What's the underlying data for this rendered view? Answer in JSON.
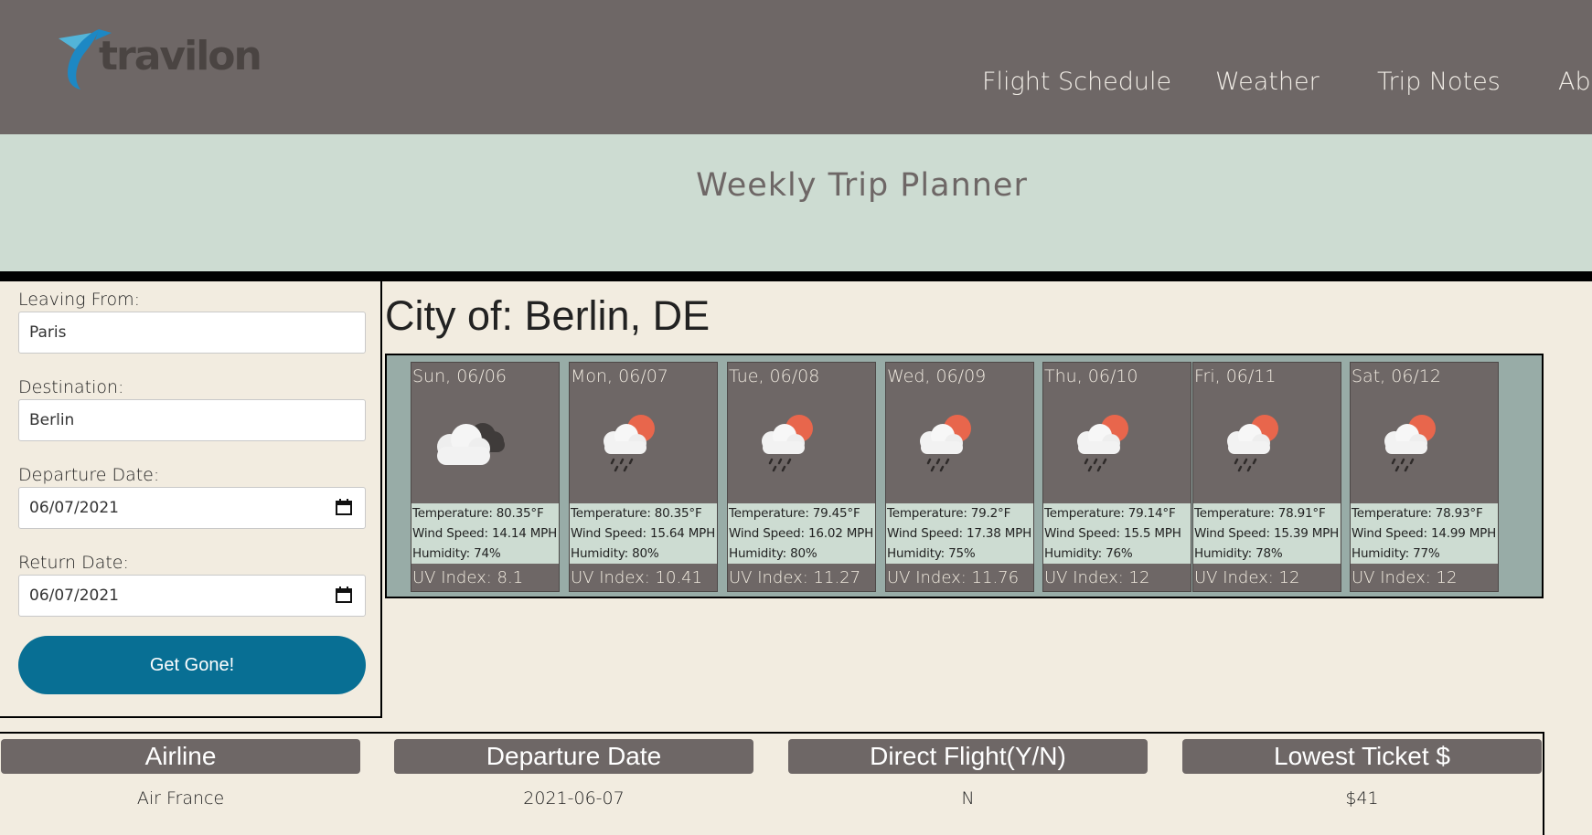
{
  "header": {
    "logo_text": "travilon",
    "nav": [
      "Flight Schedule",
      "Weather",
      "Trip Notes",
      "Abo"
    ]
  },
  "banner": {
    "title": "Weekly Trip Planner"
  },
  "form": {
    "leaving_label": "Leaving From:",
    "leaving_value": "Paris",
    "destination_label": "Destination:",
    "destination_value": "Berlin",
    "departure_label": "Departure Date:",
    "departure_value": "06/07/2021",
    "return_label": "Return Date:",
    "return_value": "06/07/2021",
    "submit_label": "Get Gone!"
  },
  "city": {
    "title": "City of: Berlin, DE"
  },
  "forecast": [
    {
      "date": "Sun, 06/06",
      "icon": "cloudy-icon",
      "temp": "Temperature: 80.35°F",
      "wind": "Wind Speed: 14.14 MPH",
      "humidity": "Humidity: 74%",
      "uv": "UV Index: 8.1"
    },
    {
      "date": "Mon, 06/07",
      "icon": "rain-sun-icon",
      "temp": "Temperature: 80.35°F",
      "wind": "Wind Speed: 15.64 MPH",
      "humidity": "Humidity: 80%",
      "uv": "UV Index: 10.41"
    },
    {
      "date": "Tue, 06/08",
      "icon": "rain-sun-icon",
      "temp": "Temperature: 79.45°F",
      "wind": "Wind Speed: 16.02 MPH",
      "humidity": "Humidity: 80%",
      "uv": "UV Index: 11.27"
    },
    {
      "date": "Wed, 06/09",
      "icon": "rain-sun-icon",
      "temp": "Temperature: 79.2°F",
      "wind": "Wind Speed: 17.38 MPH",
      "humidity": "Humidity: 75%",
      "uv": "UV Index: 11.76"
    },
    {
      "date": "Thu, 06/10",
      "icon": "rain-sun-icon",
      "temp": "Temperature: 79.14°F",
      "wind": "Wind Speed: 15.5 MPH",
      "humidity": "Humidity: 76%",
      "uv": "UV Index: 12"
    },
    {
      "date": "Fri, 06/11",
      "icon": "rain-sun-icon",
      "temp": "Temperature: 78.91°F",
      "wind": "Wind Speed: 15.39 MPH",
      "humidity": "Humidity: 78%",
      "uv": "UV Index: 12"
    },
    {
      "date": "Sat, 06/12",
      "icon": "rain-sun-icon",
      "temp": "Temperature: 78.93°F",
      "wind": "Wind Speed: 14.99 MPH",
      "humidity": "Humidity: 77%",
      "uv": "UV Index: 12"
    }
  ],
  "flights": {
    "headers": [
      "Airline",
      "Departure Date",
      "Direct Flight(Y/N)",
      "Lowest Ticket $"
    ],
    "rows": [
      [
        "Air France",
        "2021-06-07",
        "N",
        "$41"
      ]
    ]
  }
}
